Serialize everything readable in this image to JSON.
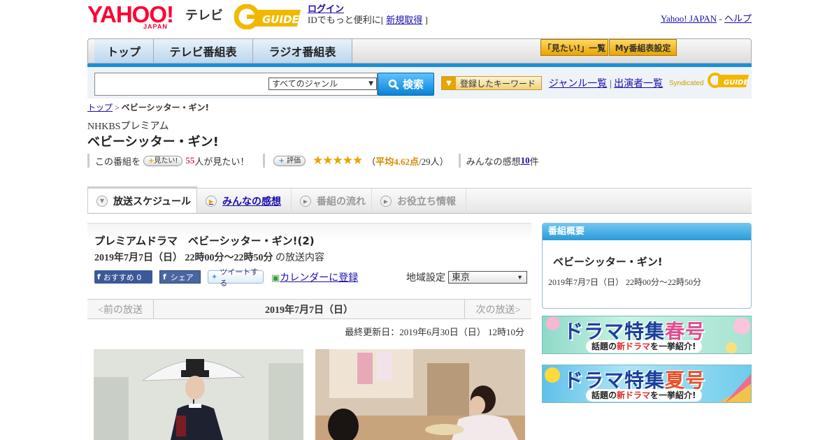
{
  "header": {
    "logo_text": "YAHOO!",
    "logo_sub": "JAPAN",
    "service_name": "テレビ",
    "login_label": "ログイン",
    "login_note_prefix": "IDでもっと便利に[ ",
    "register_label": "新規取得",
    "login_note_suffix": " ]",
    "yahoo_link": "Yahoo! JAPAN",
    "link_sep": " - ",
    "help_link": "ヘルプ"
  },
  "nav": {
    "tabs": [
      "トップ",
      "テレビ番組表",
      "ラジオ番組表"
    ],
    "want_list": "「見たい!」一覧",
    "my_schedule": "My番組表設定"
  },
  "search": {
    "input_value": "",
    "genre_selected": "すべてのジャンル",
    "button_label": "検索",
    "keyword_button": "登録したキーワード",
    "genre_list_link": "ジャンル一覧",
    "sep": " | ",
    "cast_list_link": "出演者一覧",
    "syndicated": "Syndicated"
  },
  "breadcrumb": {
    "top": "トップ",
    "sep": " > ",
    "current": "ベビーシッター・ギン!"
  },
  "program": {
    "channel": "NHKBSプレミアム",
    "title": "ベビーシッター・ギン!",
    "want_prefix": "この番組を",
    "want_button": "見たい!",
    "want_count": "55",
    "want_suffix": "人が見たい！",
    "rate_button": "評価",
    "stars": "★★★★★",
    "avg_open": "（",
    "avg_score": "平均4.62点",
    "avg_rest": "/29人）",
    "impressions_prefix": "みんなの感想 ",
    "impressions_count": "10",
    "impressions_suffix": "件"
  },
  "tabs2": [
    "放送スケジュール",
    "みんなの感想",
    "番組の流れ",
    "お役立ち情報"
  ],
  "episode": {
    "title": "プレミアムドラマ　ベビーシッター・ギン!(2)",
    "datetime": "2019年7月7日（日） 22時00分～22時50分",
    "datetime_suffix": " の放送内容",
    "fb_recommend": "おすすめ 0",
    "fb_share": "シェア",
    "tweet": "ツイートする",
    "calendar": "カレンダーに登録",
    "region_label": "地域設定",
    "region_value": "東京"
  },
  "pager": {
    "prev": "<前の放送",
    "current": "2019年7月7日（日）",
    "next": "次の放送>"
  },
  "updated": "最終更新日：2019年6月30日（日） 12時10分",
  "overview": {
    "header": "番組概要",
    "title": "ベビーシッター・ギン!",
    "datetime": "2019年7月7日（日） 22時00分～22時50分"
  },
  "banners": [
    {
      "main": "ドラマ特集",
      "season": "春号",
      "sub_a": "話題の",
      "sub_b": "新ドラマ",
      "sub_c": "を一挙紹介!"
    },
    {
      "main": "ドラマ特集",
      "season": "夏号",
      "sub_a": "話題の",
      "sub_b": "新ドラマ",
      "sub_c": "を一挙紹介!"
    }
  ]
}
